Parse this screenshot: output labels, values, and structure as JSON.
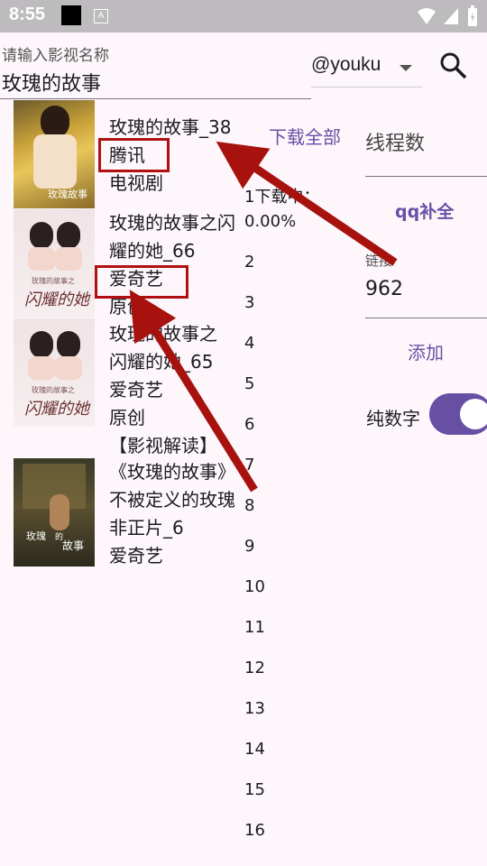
{
  "status_bar": {
    "time": "8:55",
    "app_badge": "A"
  },
  "search": {
    "label": "请输入影视名称",
    "value": "玫瑰的故事"
  },
  "source": {
    "selected": "@youku"
  },
  "results": [
    {
      "title": "玫瑰的故事_38",
      "platform": "腾讯",
      "category": "电视剧",
      "poster_text": "玫瑰故事"
    },
    {
      "title_line1": "玫瑰的故事之闪",
      "title_line2": "耀的她_66",
      "platform": "爱奇艺",
      "category": "原创",
      "poster_text_top": "玫瑰的故事之",
      "poster_text_big": "闪耀的她"
    },
    {
      "title_line1": "玫瑰的故事之",
      "title_line2": "闪耀的她_65",
      "platform": "爱奇艺",
      "category": "原创",
      "poster_text_top": "玫瑰的故事之",
      "poster_text_big": "闪耀的她"
    },
    {
      "line1": "【影视解读】",
      "line2": "《玫瑰的故事》",
      "line3": "不被定义的玫瑰",
      "line4": "非正片_6",
      "platform": "爱奇艺",
      "poster_text_1": "玫瑰",
      "poster_text_2": "的",
      "poster_text_3": "故事"
    }
  ],
  "downloads": {
    "download_all": "下载全部",
    "status_line1": "1下载中：",
    "status_line2": "0.00%",
    "numbers": [
      "2",
      "3",
      "4",
      "5",
      "6",
      "7",
      "8",
      "9",
      "10",
      "11",
      "12",
      "13",
      "14",
      "15",
      "16"
    ]
  },
  "settings": {
    "thread_label": "线程数",
    "qq_fill": "qq补全",
    "link_label": "链接",
    "link_value": "962",
    "add": "添加",
    "pure_digits": "纯数字",
    "pure_digits_on": true
  },
  "colors": {
    "accent": "#6750a4",
    "annotation": "#b01010",
    "status_bar": "#bdbbbd"
  }
}
